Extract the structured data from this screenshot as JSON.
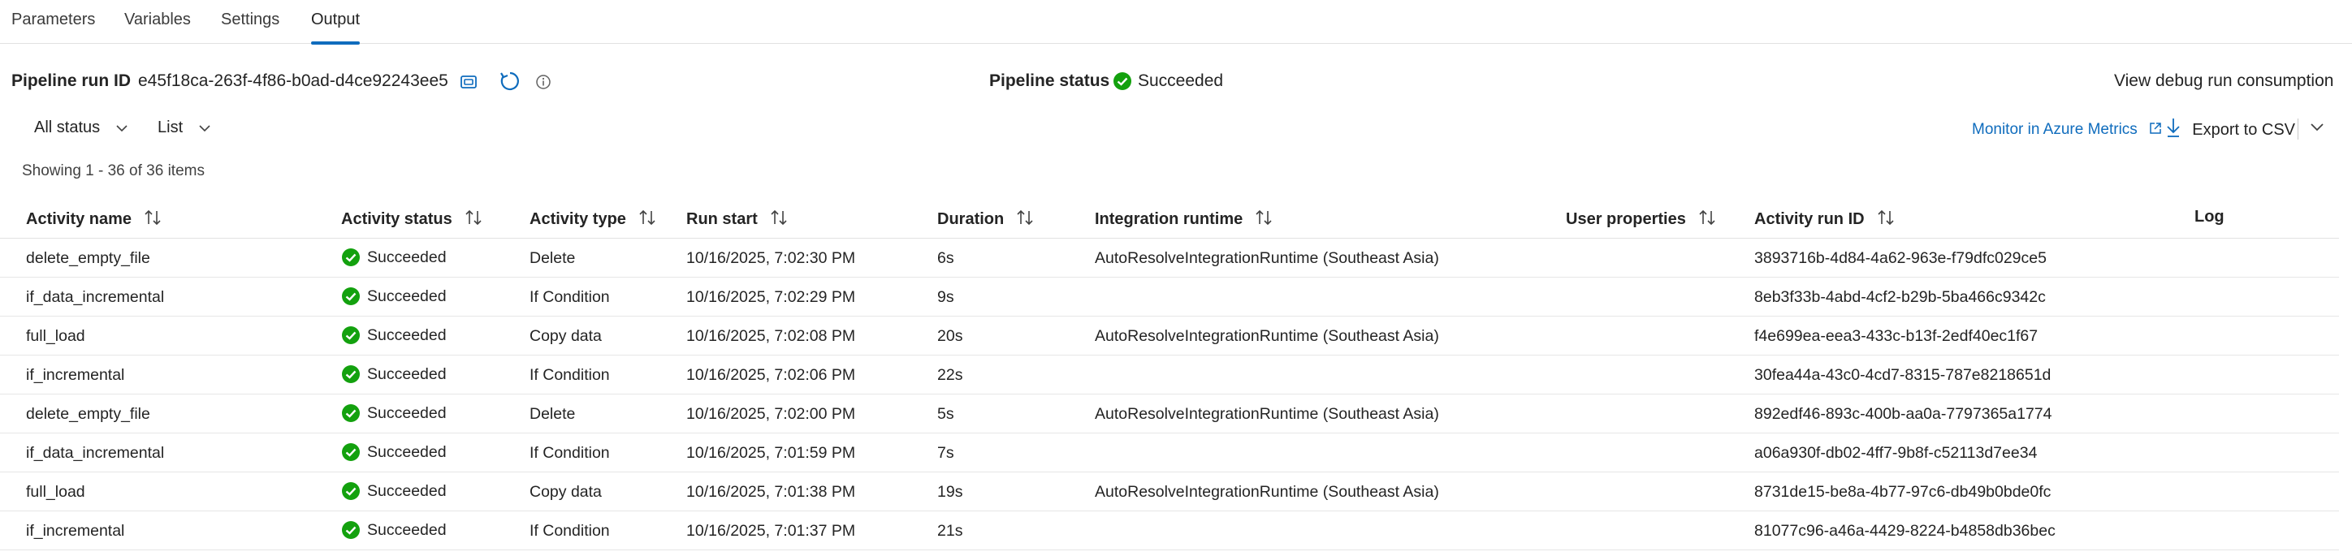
{
  "tabs": [
    {
      "label": "Parameters"
    },
    {
      "label": "Variables"
    },
    {
      "label": "Settings"
    },
    {
      "label": "Output"
    }
  ],
  "run_info": {
    "run_id_label": "Pipeline run ID",
    "run_id_value": "e45f18ca-263f-4f86-b0ad-d4ce92243ee5",
    "status_label": "Pipeline status",
    "status_value": "Succeeded",
    "debug_link": "View debug run consumption"
  },
  "filters": {
    "status": "All status",
    "view": "List"
  },
  "toolbar": {
    "monitor_link": "Monitor in Azure Metrics",
    "export_label": "Export to CSV"
  },
  "showing_text": "Showing 1 - 36 of 36 items",
  "columns": {
    "activity_name": "Activity name",
    "activity_status": "Activity status",
    "activity_type": "Activity type",
    "run_start": "Run start",
    "duration": "Duration",
    "integration_runtime": "Integration runtime",
    "user_properties": "User properties",
    "activity_run_id": "Activity run ID",
    "log": "Log"
  },
  "rows": [
    {
      "name": "delete_empty_file",
      "status": "Succeeded",
      "type": "Delete",
      "start": "10/16/2025, 7:02:30 PM",
      "duration": "6s",
      "runtime": "AutoResolveIntegrationRuntime (Southeast Asia)",
      "run_id": "3893716b-4d84-4a62-963e-f79dfc029ce5"
    },
    {
      "name": "if_data_incremental",
      "status": "Succeeded",
      "type": "If Condition",
      "start": "10/16/2025, 7:02:29 PM",
      "duration": "9s",
      "runtime": "",
      "run_id": "8eb3f33b-4abd-4cf2-b29b-5ba466c9342c"
    },
    {
      "name": "full_load",
      "status": "Succeeded",
      "type": "Copy data",
      "start": "10/16/2025, 7:02:08 PM",
      "duration": "20s",
      "runtime": "AutoResolveIntegrationRuntime (Southeast Asia)",
      "run_id": "f4e699ea-eea3-433c-b13f-2edf40ec1f67"
    },
    {
      "name": "if_incremental",
      "status": "Succeeded",
      "type": "If Condition",
      "start": "10/16/2025, 7:02:06 PM",
      "duration": "22s",
      "runtime": "",
      "run_id": "30fea44a-43c0-4cd7-8315-787e8218651d"
    },
    {
      "name": "delete_empty_file",
      "status": "Succeeded",
      "type": "Delete",
      "start": "10/16/2025, 7:02:00 PM",
      "duration": "5s",
      "runtime": "AutoResolveIntegrationRuntime (Southeast Asia)",
      "run_id": "892edf46-893c-400b-aa0a-7797365a1774"
    },
    {
      "name": "if_data_incremental",
      "status": "Succeeded",
      "type": "If Condition",
      "start": "10/16/2025, 7:01:59 PM",
      "duration": "7s",
      "runtime": "",
      "run_id": "a06a930f-db02-4ff7-9b8f-c52113d7ee34"
    },
    {
      "name": "full_load",
      "status": "Succeeded",
      "type": "Copy data",
      "start": "10/16/2025, 7:01:38 PM",
      "duration": "19s",
      "runtime": "AutoResolveIntegrationRuntime (Southeast Asia)",
      "run_id": "8731de15-be8a-4b77-97c6-db49b0bde0fc"
    },
    {
      "name": "if_incremental",
      "status": "Succeeded",
      "type": "If Condition",
      "start": "10/16/2025, 7:01:37 PM",
      "duration": "21s",
      "runtime": "",
      "run_id": "81077c96-a46a-4429-8224-b4858db36bec"
    }
  ],
  "colors": {
    "accent": "#0f6cbd",
    "success": "#13a10e",
    "text": "#242424",
    "border": "#e1e1e1"
  },
  "icons": {
    "copy": "copy-icon",
    "refresh": "refresh-icon",
    "info": "info-icon",
    "success": "success-check-icon",
    "chevron": "chevron-down-icon",
    "sort": "sort-arrows-icon",
    "external": "external-link-icon",
    "download": "download-icon"
  }
}
